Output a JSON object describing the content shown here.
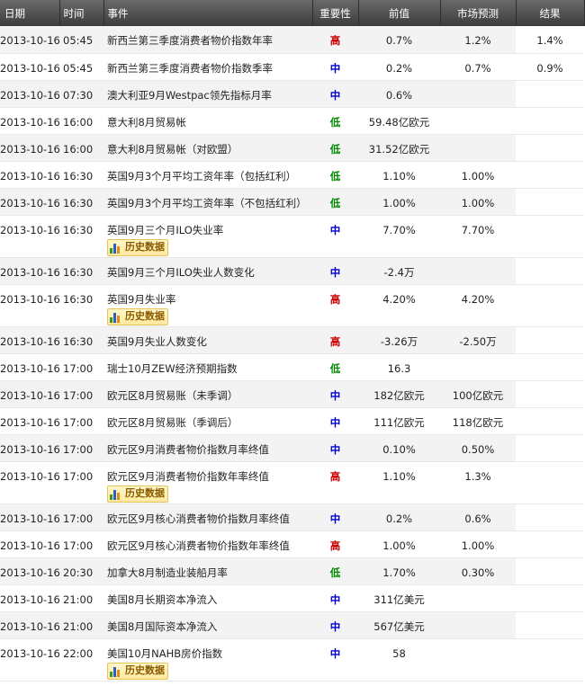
{
  "header": {
    "date": "日期",
    "time": "时间",
    "event": "事件",
    "importance": "重要性",
    "previous": "前值",
    "forecast": "市场预测",
    "actual": "结果"
  },
  "history_label": "历史数据",
  "importance_colors": {
    "high": "#cc0000",
    "medium": "#0000cc",
    "low": "#008800"
  },
  "rows": [
    {
      "date": "2013-10-16",
      "time": "05:45",
      "event": "新西兰第三季度消费者物价指数年率",
      "importance": "高",
      "level": "high",
      "previous": "0.7%",
      "forecast": "1.2%",
      "actual": "1.4%",
      "history": false
    },
    {
      "date": "2013-10-16",
      "time": "05:45",
      "event": "新西兰第三季度消费者物价指数季率",
      "importance": "中",
      "level": "medium",
      "previous": "0.2%",
      "forecast": "0.7%",
      "actual": "0.9%",
      "history": false
    },
    {
      "date": "2013-10-16",
      "time": "07:30",
      "event": "澳大利亚9月Westpac领先指标月率",
      "importance": "中",
      "level": "medium",
      "previous": "0.6%",
      "forecast": "",
      "actual": "",
      "history": false
    },
    {
      "date": "2013-10-16",
      "time": "16:00",
      "event": "意大利8月贸易帐",
      "importance": "低",
      "level": "low",
      "previous": "59.48亿欧元",
      "forecast": "",
      "actual": "",
      "history": false
    },
    {
      "date": "2013-10-16",
      "time": "16:00",
      "event": "意大利8月贸易帐（对欧盟）",
      "importance": "低",
      "level": "low",
      "previous": "31.52亿欧元",
      "forecast": "",
      "actual": "",
      "history": false
    },
    {
      "date": "2013-10-16",
      "time": "16:30",
      "event": "英国9月3个月平均工资年率（包括红利）",
      "importance": "低",
      "level": "low",
      "previous": "1.10%",
      "forecast": "1.00%",
      "actual": "",
      "history": false
    },
    {
      "date": "2013-10-16",
      "time": "16:30",
      "event": "英国9月3个月平均工资年率（不包括红利）",
      "importance": "低",
      "level": "low",
      "previous": "1.00%",
      "forecast": "1.00%",
      "actual": "",
      "history": false
    },
    {
      "date": "2013-10-16",
      "time": "16:30",
      "event": "英国9月三个月ILO失业率",
      "importance": "中",
      "level": "medium",
      "previous": "7.70%",
      "forecast": "7.70%",
      "actual": "",
      "history": true
    },
    {
      "date": "2013-10-16",
      "time": "16:30",
      "event": "英国9月三个月ILO失业人数变化",
      "importance": "中",
      "level": "medium",
      "previous": "-2.4万",
      "forecast": "",
      "actual": "",
      "history": false
    },
    {
      "date": "2013-10-16",
      "time": "16:30",
      "event": "英国9月失业率",
      "importance": "高",
      "level": "high",
      "previous": "4.20%",
      "forecast": "4.20%",
      "actual": "",
      "history": true
    },
    {
      "date": "2013-10-16",
      "time": "16:30",
      "event": "英国9月失业人数变化",
      "importance": "高",
      "level": "high",
      "previous": "-3.26万",
      "forecast": "-2.50万",
      "actual": "",
      "history": false
    },
    {
      "date": "2013-10-16",
      "time": "17:00",
      "event": "瑞士10月ZEW经济预期指数",
      "importance": "低",
      "level": "low",
      "previous": "16.3",
      "forecast": "",
      "actual": "",
      "history": false
    },
    {
      "date": "2013-10-16",
      "time": "17:00",
      "event": "欧元区8月贸易账（未季调）",
      "importance": "中",
      "level": "medium",
      "previous": "182亿欧元",
      "forecast": "100亿欧元",
      "actual": "",
      "history": false
    },
    {
      "date": "2013-10-16",
      "time": "17:00",
      "event": "欧元区8月贸易账（季调后）",
      "importance": "中",
      "level": "medium",
      "previous": "111亿欧元",
      "forecast": "118亿欧元",
      "actual": "",
      "history": false
    },
    {
      "date": "2013-10-16",
      "time": "17:00",
      "event": "欧元区9月消费者物价指数月率终值",
      "importance": "中",
      "level": "medium",
      "previous": "0.10%",
      "forecast": "0.50%",
      "actual": "",
      "history": false
    },
    {
      "date": "2013-10-16",
      "time": "17:00",
      "event": "欧元区9月消费者物价指数年率终值",
      "importance": "高",
      "level": "high",
      "previous": "1.10%",
      "forecast": "1.3%",
      "actual": "",
      "history": true
    },
    {
      "date": "2013-10-16",
      "time": "17:00",
      "event": "欧元区9月核心消费者物价指数月率终值",
      "importance": "中",
      "level": "medium",
      "previous": "0.2%",
      "forecast": "0.6%",
      "actual": "",
      "history": false
    },
    {
      "date": "2013-10-16",
      "time": "17:00",
      "event": "欧元区9月核心消费者物价指数年率终值",
      "importance": "高",
      "level": "high",
      "previous": "1.00%",
      "forecast": "1.00%",
      "actual": "",
      "history": false
    },
    {
      "date": "2013-10-16",
      "time": "20:30",
      "event": "加拿大8月制造业装船月率",
      "importance": "低",
      "level": "low",
      "previous": "1.70%",
      "forecast": "0.30%",
      "actual": "",
      "history": false
    },
    {
      "date": "2013-10-16",
      "time": "21:00",
      "event": "美国8月长期资本净流入",
      "importance": "中",
      "level": "medium",
      "previous": "311亿美元",
      "forecast": "",
      "actual": "",
      "history": false
    },
    {
      "date": "2013-10-16",
      "time": "21:00",
      "event": "美国8月国际资本净流入",
      "importance": "中",
      "level": "medium",
      "previous": "567亿美元",
      "forecast": "",
      "actual": "",
      "history": false
    },
    {
      "date": "2013-10-16",
      "time": "22:00",
      "event": "美国10月NAHB房价指数",
      "importance": "中",
      "level": "medium",
      "previous": "58",
      "forecast": "",
      "actual": "",
      "history": true
    }
  ]
}
